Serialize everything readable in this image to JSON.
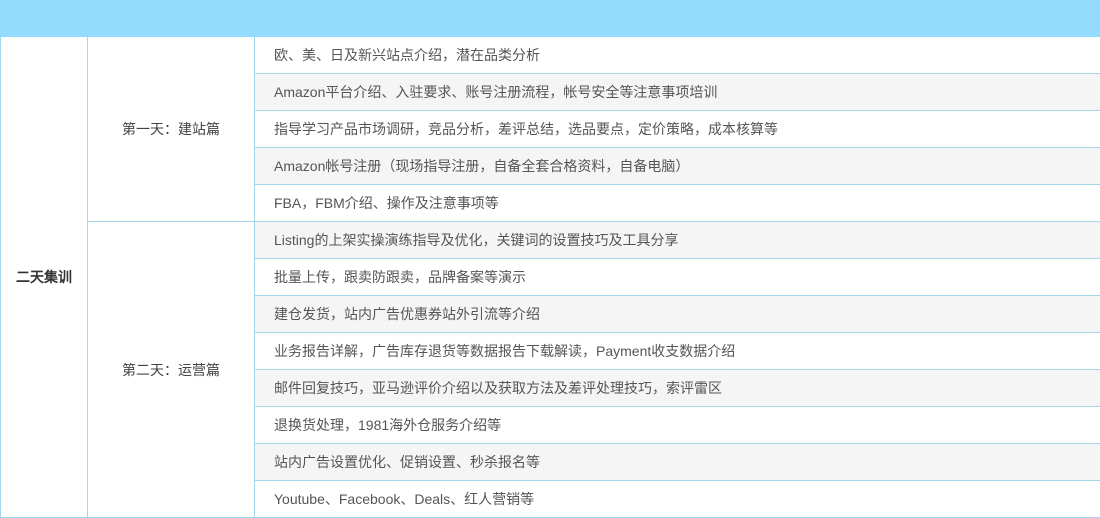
{
  "program": {
    "label": "二天集训"
  },
  "days": [
    {
      "label": "第一天：建站篇",
      "topics": [
        "欧、美、日及新兴站点介绍，潜在品类分析",
        "Amazon平台介绍、入驻要求、账号注册流程，帐号安全等注意事项培训",
        "指导学习产品市场调研，竞品分析，差评总结，选品要点，定价策略，成本核算等",
        "Amazon帐号注册（现场指导注册，自备全套合格资料，自备电脑）",
        "FBA，FBM介绍、操作及注意事项等"
      ]
    },
    {
      "label": "第二天：运营篇",
      "topics": [
        "Listing的上架实操演练指导及优化，关键词的设置技巧及工具分享",
        "批量上传，跟卖防跟卖，品牌备案等演示",
        "建仓发货，站内广告优惠券站外引流等介绍",
        "业务报告详解，广告库存退货等数据报告下载解读，Payment收支数据介绍",
        "邮件回复技巧，亚马逊评价介绍以及获取方法及差评处理技巧，索评雷区",
        "退换货处理，1981海外仓服务介绍等",
        "站内广告设置优化、促销设置、秒杀报名等",
        "Youtube、Facebook、Deals、红人营销等"
      ]
    }
  ]
}
